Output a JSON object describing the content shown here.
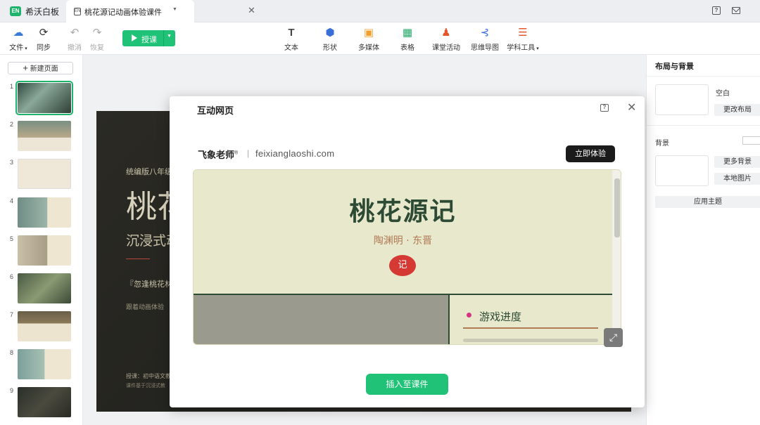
{
  "app": {
    "name": "希沃白板",
    "logo": "EN"
  },
  "tab": {
    "title": "桃花源记动画体验课件"
  },
  "toolbar": {
    "file": "文件",
    "sync": "同步",
    "undo": "撤消",
    "redo": "恢复",
    "teach": "授课",
    "text": "文本",
    "shape": "形状",
    "media": "多媒体",
    "table": "表格",
    "activity": "课堂活动",
    "mindmap": "思维导图",
    "subject": "学科工具"
  },
  "left": {
    "new_page": "新建页面",
    "thumbs": [
      "1",
      "2",
      "3",
      "4",
      "5",
      "6",
      "7",
      "8",
      "9"
    ]
  },
  "slide": {
    "line1": "统编版八年级",
    "big": "桃花",
    "line2": "沉浸式动",
    "quote": "『忽逢桃花林",
    "follow": "跟着动画体验",
    "bottom1": "授课：初中语文教",
    "bottom2": "课件基于沉浸式教"
  },
  "right": {
    "title": "布局与背景",
    "blank": "空白",
    "change_layout": "更改布局",
    "background": "背景",
    "more_bg": "更多背景",
    "local_image": "本地图片",
    "apply_theme": "应用主题"
  },
  "modal": {
    "title": "互动网页",
    "brand": "飞象老师",
    "brand_mark": "®",
    "url": "feixianglaoshi.com",
    "try": "立即体验",
    "insert": "插入至课件",
    "preview": {
      "title": "桃花源记",
      "subtitle": "陶渊明 · 东晋",
      "seal": "记",
      "progress": "游戏进度"
    }
  }
}
